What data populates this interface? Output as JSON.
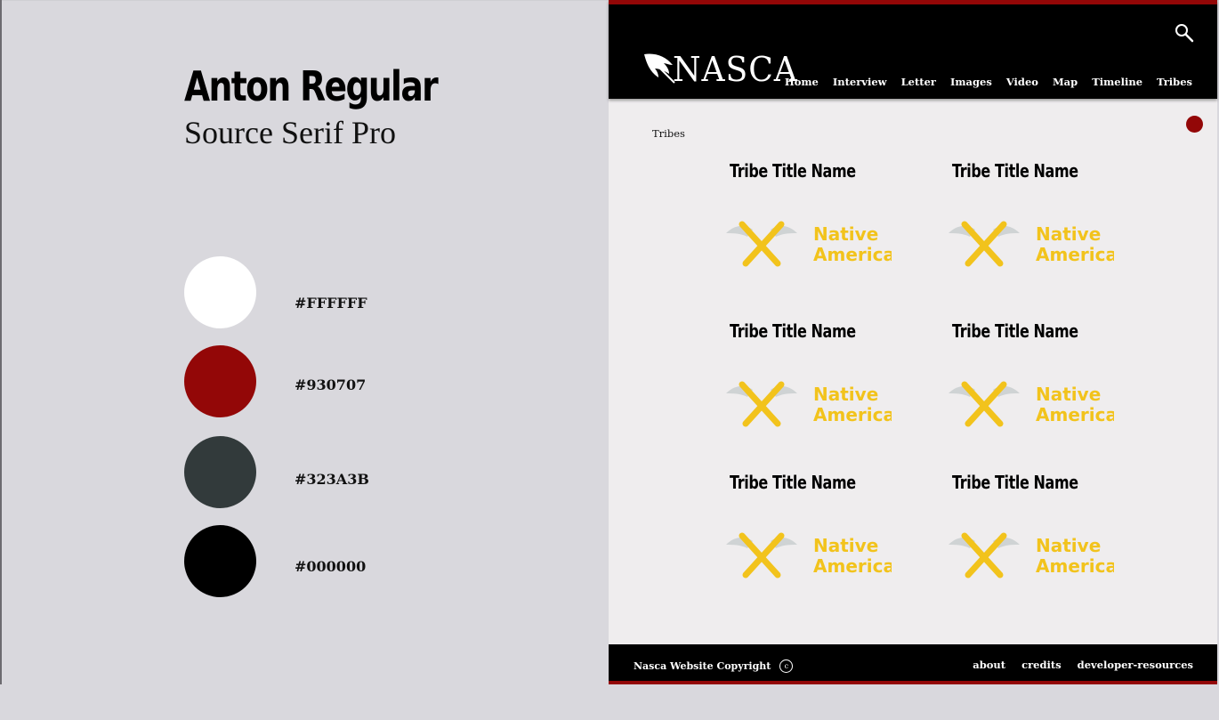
{
  "style_guide": {
    "font_sample_primary": "Anton Regular",
    "font_sample_secondary": "Source Serif Pro",
    "swatches": [
      {
        "hex": "#FFFFFF",
        "color": "#FFFFFF"
      },
      {
        "hex": "#930707",
        "color": "#930707"
      },
      {
        "hex": "#323A3B",
        "color": "#323A3B"
      },
      {
        "hex": "#000000",
        "color": "#000000"
      }
    ]
  },
  "header": {
    "logo_text": "NASCA",
    "accent_color": "#930707",
    "nav": [
      "Home",
      "Interview",
      "Letter",
      "Images",
      "Video",
      "Map",
      "Timeline",
      "Tribes"
    ]
  },
  "main": {
    "breadcrumb": "Tribes",
    "tribes": [
      {
        "title": "Tribe Title Name",
        "logo_line1": "Native",
        "logo_line2": "America"
      },
      {
        "title": "Tribe Title Name",
        "logo_line1": "Native",
        "logo_line2": "America"
      },
      {
        "title": "Tribe Title Name",
        "logo_line1": "Native",
        "logo_line2": "America"
      },
      {
        "title": "Tribe Title Name",
        "logo_line1": "Native",
        "logo_line2": "America"
      },
      {
        "title": "Tribe Title Name",
        "logo_line1": "Native",
        "logo_line2": "America"
      },
      {
        "title": "Tribe Title Name",
        "logo_line1": "Native",
        "logo_line2": "America"
      }
    ]
  },
  "footer": {
    "copyright": "Nasca Website Copyright",
    "copyright_symbol": "c",
    "links": [
      "about",
      "credits",
      "developer-resources"
    ]
  }
}
